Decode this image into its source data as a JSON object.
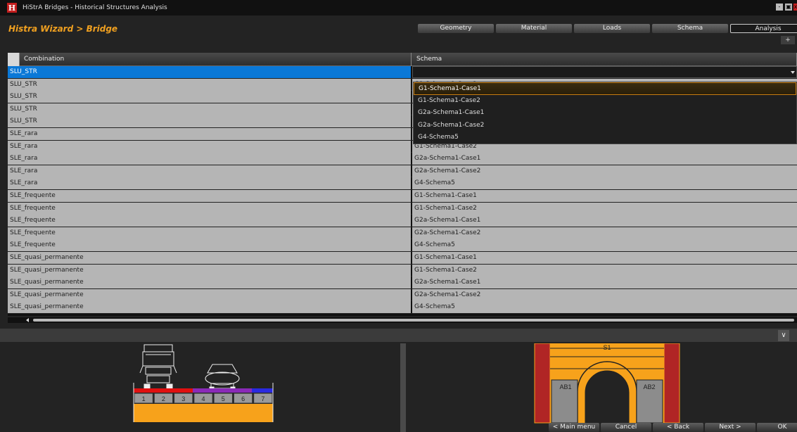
{
  "window": {
    "title": "HiStrA Bridges - Historical Structures Analysis",
    "logo": "H",
    "controls": [
      "-",
      "▣",
      "x"
    ]
  },
  "breadcrumb": "Histra Wizard > Bridge",
  "tabs": [
    {
      "label": "Geometry",
      "active": false
    },
    {
      "label": "Material",
      "active": false
    },
    {
      "label": "Loads",
      "active": false
    },
    {
      "label": "Schema",
      "active": false
    },
    {
      "label": "Analysis",
      "active": true
    }
  ],
  "add_tab_label": "+",
  "grid": {
    "columns": [
      "Combination",
      "Schema"
    ],
    "rows": [
      {
        "combination": "SLU_STR",
        "schema": ""
      },
      {
        "combination": "SLU_STR",
        "schema": "G1-Schema1-Case2"
      },
      {
        "combination": "SLU_STR",
        "schema": ""
      },
      {
        "combination": "SLU_STR",
        "schema": ""
      },
      {
        "combination": "SLU_STR",
        "schema": ""
      },
      {
        "combination": "SLE_rara",
        "schema": ""
      },
      {
        "combination": "SLE_rara",
        "schema": "G1-Schema1-Case2"
      },
      {
        "combination": "SLE_rara",
        "schema": "G2a-Schema1-Case1"
      },
      {
        "combination": "SLE_rara",
        "schema": "G2a-Schema1-Case2"
      },
      {
        "combination": "SLE_rara",
        "schema": "G4-Schema5"
      },
      {
        "combination": "SLE_frequente",
        "schema": "G1-Schema1-Case1"
      },
      {
        "combination": "SLE_frequente",
        "schema": "G1-Schema1-Case2"
      },
      {
        "combination": "SLE_frequente",
        "schema": "G2a-Schema1-Case1"
      },
      {
        "combination": "SLE_frequente",
        "schema": "G2a-Schema1-Case2"
      },
      {
        "combination": "SLE_frequente",
        "schema": "G4-Schema5"
      },
      {
        "combination": "SLE_quasi_permanente",
        "schema": "G1-Schema1-Case1"
      },
      {
        "combination": "SLE_quasi_permanente",
        "schema": "G1-Schema1-Case2"
      },
      {
        "combination": "SLE_quasi_permanente",
        "schema": "G2a-Schema1-Case1"
      },
      {
        "combination": "SLE_quasi_permanente",
        "schema": "G2a-Schema1-Case2"
      },
      {
        "combination": "SLE_quasi_permanente",
        "schema": "G4-Schema5"
      }
    ],
    "selected_row": 0
  },
  "dropdown": {
    "options": [
      "G1-Schema1-Case1",
      "G1-Schema1-Case2",
      "G2a-Schema1-Case1",
      "G2a-Schema1-Case2",
      "G4-Schema5"
    ],
    "highlighted": 0
  },
  "collapse_label": "∨",
  "deck_diagram": {
    "lanes": [
      "1",
      "2",
      "3",
      "4",
      "5",
      "6",
      "7"
    ],
    "colors": {
      "deck": "#f7a21b",
      "lane_cell": "#9a9a9a",
      "red_strip": "#e01010",
      "purple_strip": "#8a2ab8",
      "blue_strip": "#2a2ae0"
    }
  },
  "arch_diagram": {
    "labels": {
      "span": "S1",
      "left_abutment": "AB1",
      "right_abutment": "AB2"
    },
    "colors": {
      "arch": "#f7a21b",
      "pier": "#b02525",
      "abutment": "#8c8c8c"
    }
  },
  "nav": [
    "< Main menu",
    "Cancel",
    "< Back",
    "Next >",
    "OK"
  ],
  "colors": {
    "accent": "#f0a020",
    "selection": "#0a78d7",
    "brand_red": "#c41e1e"
  }
}
